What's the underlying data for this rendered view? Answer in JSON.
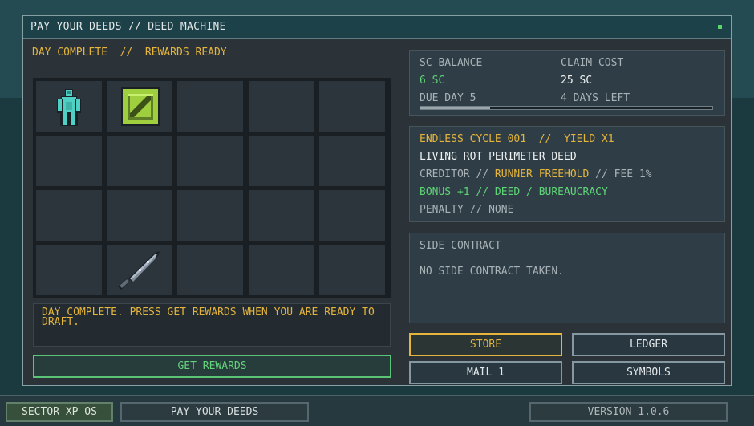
{
  "window": {
    "title": "PAY YOUR DEEDS // DEED MACHINE",
    "status": "DAY COMPLETE  //  REWARDS READY"
  },
  "inventory": {
    "rows": 4,
    "cols": 5,
    "items": [
      {
        "row": 0,
        "col": 0,
        "icon": "figure-icon"
      },
      {
        "row": 0,
        "col": 1,
        "icon": "crate-icon"
      },
      {
        "row": 3,
        "col": 1,
        "icon": "knife-icon"
      }
    ]
  },
  "message": "DAY COMPLETE. PRESS GET REWARDS WHEN YOU ARE READY TO DRAFT.",
  "get_rewards_label": "GET REWARDS",
  "balance": {
    "sc_label": "SC BALANCE",
    "sc_value": "6 SC",
    "claim_label": "CLAIM COST",
    "claim_value": "25 SC",
    "due_label": "DUE DAY 5",
    "days_left": "4 DAYS LEFT",
    "progress": 0.24
  },
  "cycle": {
    "header": "ENDLESS CYCLE 001  //  YIELD X1",
    "deed_name": "LIVING ROT PERIMETER DEED",
    "creditor_prefix": "CREDITOR //",
    "creditor_name": "RUNNER FREEHOLD",
    "creditor_suffix": "// FEE 1%",
    "bonus": "BONUS +1 // DEED / BUREAUCRACY",
    "penalty": "PENALTY // NONE"
  },
  "side_contract": {
    "title": "SIDE CONTRACT",
    "text": "NO SIDE CONTRACT TAKEN."
  },
  "buttons": {
    "store": "STORE",
    "ledger": "LEDGER",
    "mail": "MAIL 1",
    "symbols": "SYMBOLS"
  },
  "taskbar": {
    "os": "SECTOR XP OS",
    "app": "PAY YOUR DEEDS",
    "version": "VERSION 1.0.6"
  },
  "colors": {
    "accent_amber": "#e4b43c",
    "accent_green": "#5fd477",
    "window_bg": "#2b3339",
    "desktop_bg": "#1d3e44"
  }
}
